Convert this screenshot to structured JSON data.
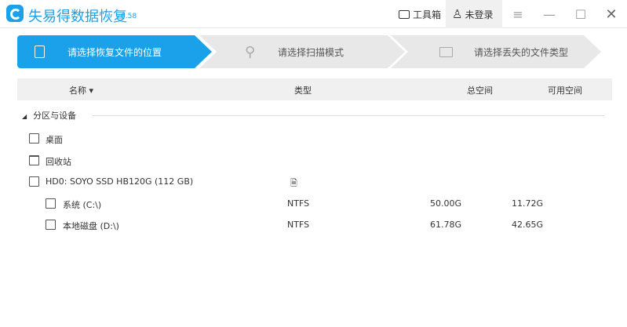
{
  "app": {
    "title": "失易得数据恢复",
    "version": "6.58"
  },
  "titlebar": {
    "toolbox": "工具箱",
    "login": "未登录"
  },
  "steps": [
    "请选择恢复文件的位置",
    "请选择扫描模式",
    "请选择丢失的文件类型"
  ],
  "columns": {
    "name": "名称",
    "type": "类型",
    "total": "总空间",
    "free": "可用空间"
  },
  "section": "分区与设备",
  "items": [
    {
      "name": "桌面"
    },
    {
      "name": "回收站"
    },
    {
      "name": "HD0: SOYO SSD HB120G (112 GB)"
    },
    {
      "name": "系统 (C:\\)",
      "type": "NTFS",
      "total": "50.00G",
      "free": "11.72G"
    },
    {
      "name": "本地磁盘 (D:\\)",
      "type": "NTFS",
      "total": "61.78G",
      "free": "42.65G"
    }
  ],
  "colors": {
    "accent": "#1ba1ea"
  }
}
